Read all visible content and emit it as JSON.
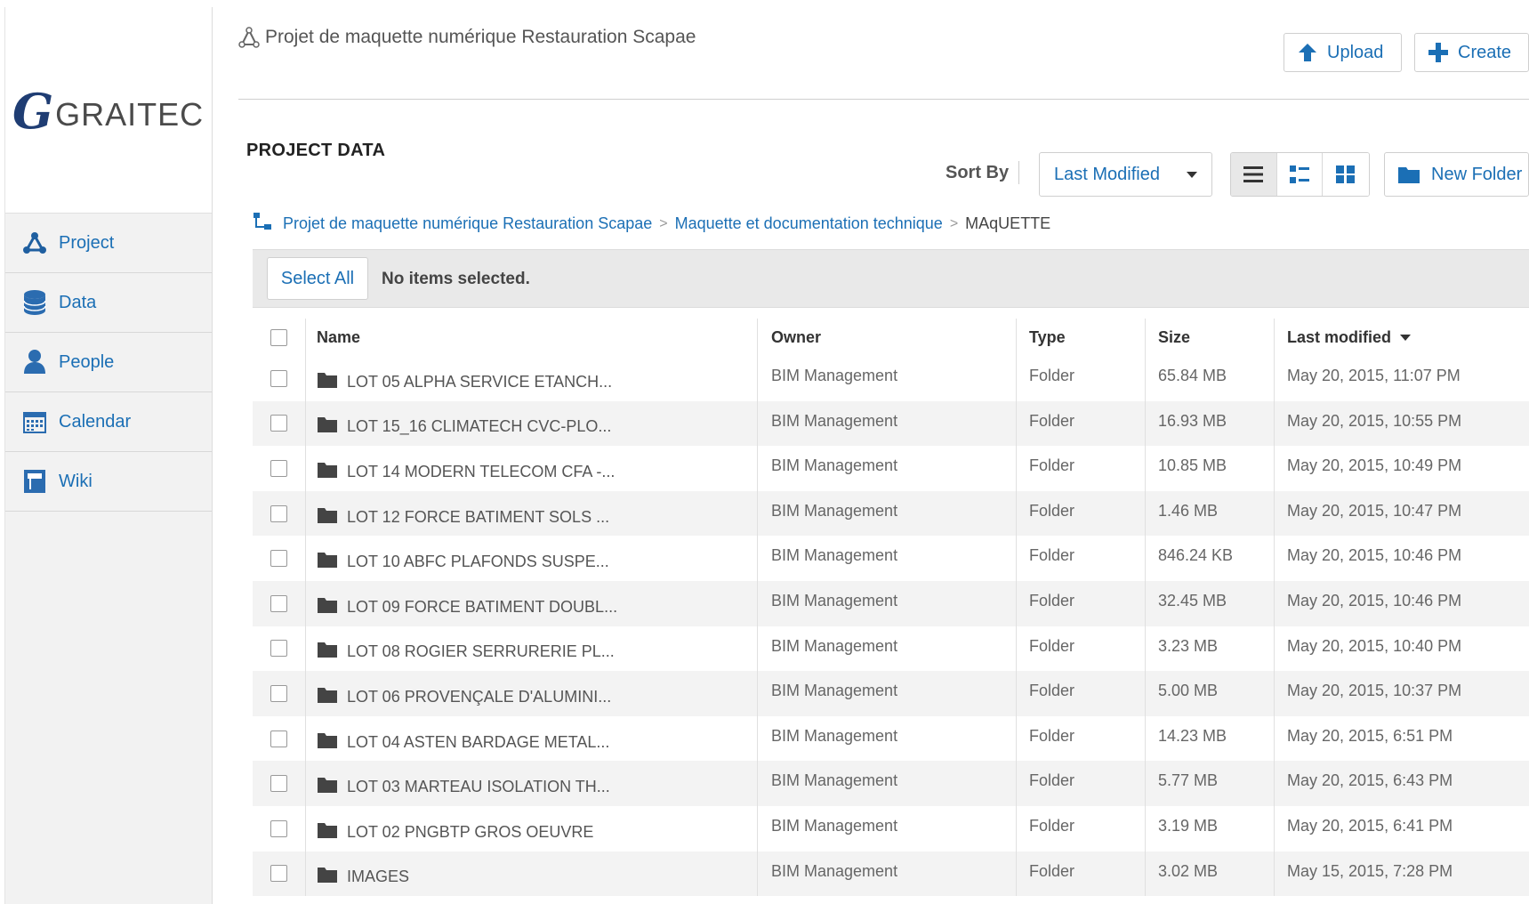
{
  "brand": {
    "logo_text": "GRAITEC",
    "logo_mark": "G"
  },
  "sidebar": {
    "items": [
      {
        "label": "Project",
        "icon": "project-icon"
      },
      {
        "label": "Data",
        "icon": "database-icon"
      },
      {
        "label": "People",
        "icon": "person-icon"
      },
      {
        "label": "Calendar",
        "icon": "calendar-icon"
      },
      {
        "label": "Wiki",
        "icon": "wiki-icon"
      }
    ]
  },
  "header": {
    "project_title": "Projet de maquette numérique Restauration Scapae",
    "upload_label": "Upload",
    "create_label": "Create"
  },
  "toolbar": {
    "section_title": "PROJECT DATA",
    "sort_label": "Sort By",
    "sort_value": "Last Modified",
    "new_folder_label": "New Folder",
    "active_view": "list"
  },
  "breadcrumb": {
    "items": [
      "Projet de maquette numérique Restauration Scapae",
      "Maquette et documentation technique"
    ],
    "current": "MAqUETTE",
    "separator": ">"
  },
  "selection": {
    "select_all_label": "Select All",
    "status": "No items selected."
  },
  "table": {
    "columns": [
      "Name",
      "Owner",
      "Type",
      "Size",
      "Last modified"
    ],
    "rows": [
      {
        "name": "LOT 05 ALPHA SERVICE ETANCH...",
        "owner": "BIM Management",
        "type": "Folder",
        "size": "65.84 MB",
        "modified": "May 20, 2015, 11:07 PM"
      },
      {
        "name": "LOT 15_16 CLIMATECH CVC-PLO...",
        "owner": "BIM Management",
        "type": "Folder",
        "size": "16.93 MB",
        "modified": "May 20, 2015, 10:55 PM"
      },
      {
        "name": "LOT 14 MODERN TELECOM CFA -...",
        "owner": "BIM Management",
        "type": "Folder",
        "size": "10.85 MB",
        "modified": "May 20, 2015, 10:49 PM"
      },
      {
        "name": "LOT 12 FORCE BATIMENT SOLS ...",
        "owner": "BIM Management",
        "type": "Folder",
        "size": "1.46 MB",
        "modified": "May 20, 2015, 10:47 PM"
      },
      {
        "name": "LOT 10 ABFC PLAFONDS SUSPE...",
        "owner": "BIM Management",
        "type": "Folder",
        "size": "846.24 KB",
        "modified": "May 20, 2015, 10:46 PM"
      },
      {
        "name": "LOT 09 FORCE BATIMENT DOUBL...",
        "owner": "BIM Management",
        "type": "Folder",
        "size": "32.45 MB",
        "modified": "May 20, 2015, 10:46 PM"
      },
      {
        "name": "LOT 08 ROGIER SERRURERIE PL...",
        "owner": "BIM Management",
        "type": "Folder",
        "size": "3.23 MB",
        "modified": "May 20, 2015, 10:40 PM"
      },
      {
        "name": "LOT 06 PROVENÇALE D'ALUMINI...",
        "owner": "BIM Management",
        "type": "Folder",
        "size": "5.00 MB",
        "modified": "May 20, 2015, 10:37 PM"
      },
      {
        "name": "LOT 04 ASTEN BARDAGE METAL...",
        "owner": "BIM Management",
        "type": "Folder",
        "size": "14.23 MB",
        "modified": "May 20, 2015, 6:51 PM"
      },
      {
        "name": "LOT 03 MARTEAU ISOLATION TH...",
        "owner": "BIM Management",
        "type": "Folder",
        "size": "5.77 MB",
        "modified": "May 20, 2015, 6:43 PM"
      },
      {
        "name": "LOT 02 PNGBTP GROS OEUVRE",
        "owner": "BIM Management",
        "type": "Folder",
        "size": "3.19 MB",
        "modified": "May 20, 2015, 6:41 PM"
      },
      {
        "name": "IMAGES",
        "owner": "BIM Management",
        "type": "Folder",
        "size": "3.02 MB",
        "modified": "May 15, 2015, 7:28 PM"
      }
    ]
  },
  "colors": {
    "link": "#1b6fb5",
    "logo_mark": "#1f3d73",
    "sidebar_bg": "#f2f2f2",
    "row_alt": "#f3f3f3",
    "folder": "#444444"
  }
}
